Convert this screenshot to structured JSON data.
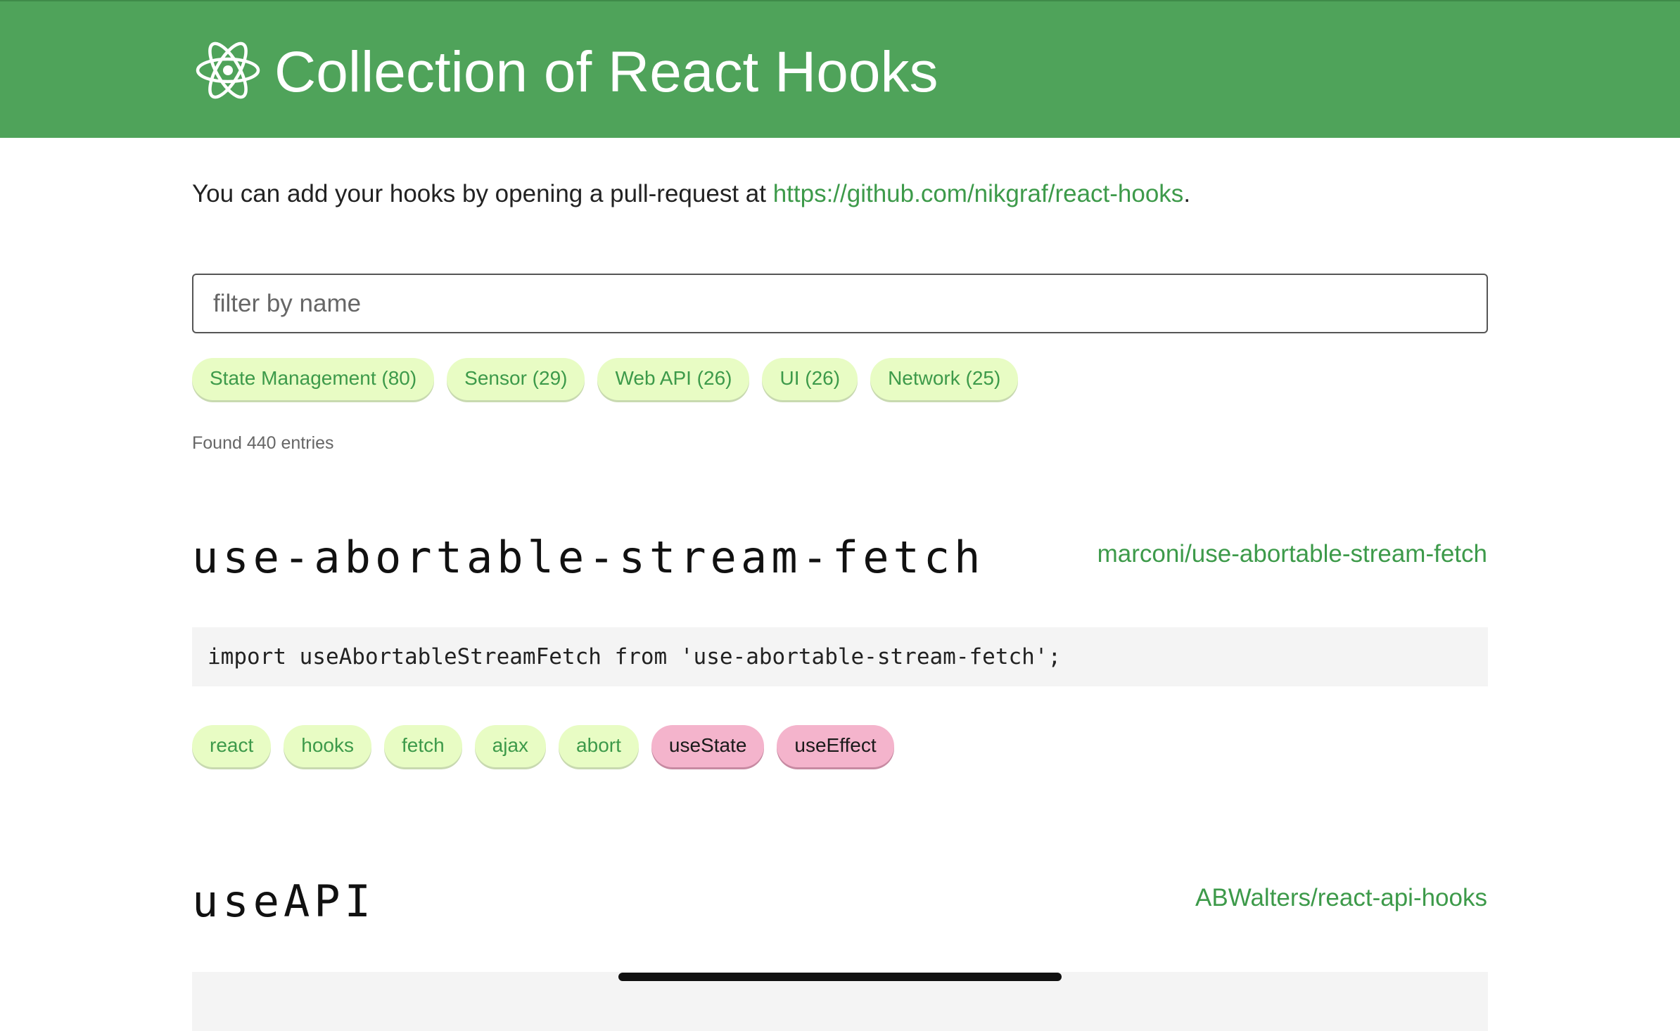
{
  "header": {
    "title": "Collection of React Hooks",
    "logo_icon": "react-atom-icon",
    "background_color": "#4fa35a"
  },
  "intro": {
    "text": "You can add your hooks by opening a pull-request at ",
    "link": "https://github.com/nikgraf/react-hooks",
    "suffix": "."
  },
  "search": {
    "placeholder": "filter by name",
    "value": ""
  },
  "categories": [
    {
      "label": "State Management (80)"
    },
    {
      "label": "Sensor (29)"
    },
    {
      "label": "Web API (26)"
    },
    {
      "label": "UI (26)"
    },
    {
      "label": "Network (25)"
    }
  ],
  "found_text": "Found 440 entries",
  "entries": [
    {
      "name": "use-abortable-stream-fetch",
      "repo": "marconi/use-abortable-stream-fetch",
      "import": "import useAbortableStreamFetch from 'use-abortable-stream-fetch';",
      "tags": [
        {
          "label": "react",
          "kind": "keyword"
        },
        {
          "label": "hooks",
          "kind": "keyword"
        },
        {
          "label": "fetch",
          "kind": "keyword"
        },
        {
          "label": "ajax",
          "kind": "keyword"
        },
        {
          "label": "abort",
          "kind": "keyword"
        },
        {
          "label": "useState",
          "kind": "hook"
        },
        {
          "label": "useEffect",
          "kind": "hook"
        }
      ]
    },
    {
      "name": "useAPI",
      "repo": "ABWalters/react-api-hooks",
      "import": ""
    }
  ],
  "colors": {
    "accent_green": "#3d9a4a",
    "keyword_tag": "#e8fcc4",
    "hook_tag": "#f4b4cc"
  }
}
